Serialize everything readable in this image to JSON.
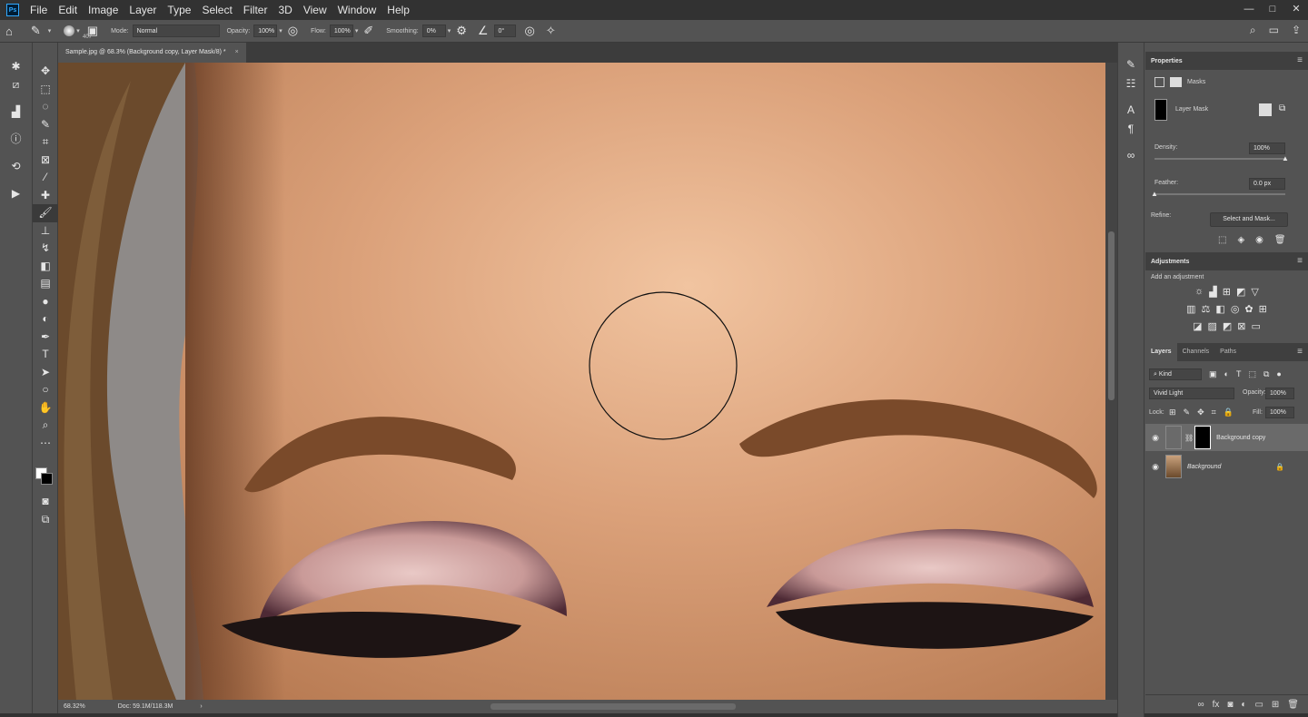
{
  "menubar": {
    "app_logo": "Ps",
    "items": [
      "File",
      "Edit",
      "Image",
      "Layer",
      "Type",
      "Select",
      "Filter",
      "3D",
      "View",
      "Window",
      "Help"
    ],
    "win_minimize": "—",
    "win_restore": "□",
    "win_close": "✕"
  },
  "options": {
    "brush_size": "407",
    "mode_label": "Mode:",
    "mode_value": "Normal",
    "opacity_label": "Opacity:",
    "opacity_value": "100%",
    "flow_label": "Flow:",
    "flow_value": "100%",
    "smoothing_label": "Smoothing:",
    "smoothing_value": "0%",
    "angle_value": "0°"
  },
  "document": {
    "tab_title": "Sample.jpg @ 68.3% (Background copy, Layer Mask/8) *",
    "tab_close": "×",
    "zoom": "68.32%",
    "doc_info": "Doc: 59.1M/118.3M"
  },
  "properties": {
    "title": "Properties",
    "masks_label": "Masks",
    "layer_mask_label": "Layer Mask",
    "density_label": "Density:",
    "density_value": "100%",
    "density_level": 1.0,
    "feather_label": "Feather:",
    "feather_value": "0.0 px",
    "feather_level": 0.0,
    "refine_label": "Refine:",
    "select_and_mask": "Select and Mask..."
  },
  "adjustments": {
    "title": "Adjustments",
    "add_label": "Add an adjustment"
  },
  "layers": {
    "tabs": [
      "Layers",
      "Channels",
      "Paths"
    ],
    "filter_kind": "Kind",
    "blend_mode": "Vivid Light",
    "opacity_label": "Opacity:",
    "opacity_value": "100%",
    "lock_label": "Lock:",
    "fill_label": "Fill:",
    "fill_value": "100%",
    "items": [
      {
        "name": "Background copy",
        "selected": true
      },
      {
        "name": "Background",
        "selected": false
      }
    ]
  },
  "colors": {
    "menubar_bg": "#323232",
    "panel_bg": "#535353",
    "skin_base": "#d49a6e",
    "brow": "#7a4a2a"
  }
}
